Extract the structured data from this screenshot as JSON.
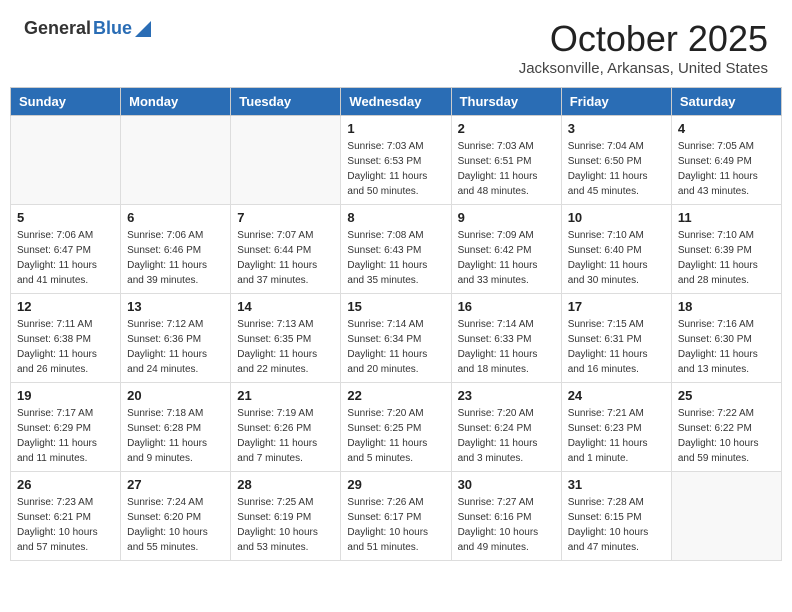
{
  "header": {
    "logo_general": "General",
    "logo_blue": "Blue",
    "month_title": "October 2025",
    "location": "Jacksonville, Arkansas, United States"
  },
  "calendar": {
    "days_of_week": [
      "Sunday",
      "Monday",
      "Tuesday",
      "Wednesday",
      "Thursday",
      "Friday",
      "Saturday"
    ],
    "weeks": [
      [
        {
          "day": "",
          "info": ""
        },
        {
          "day": "",
          "info": ""
        },
        {
          "day": "",
          "info": ""
        },
        {
          "day": "1",
          "info": "Sunrise: 7:03 AM\nSunset: 6:53 PM\nDaylight: 11 hours\nand 50 minutes."
        },
        {
          "day": "2",
          "info": "Sunrise: 7:03 AM\nSunset: 6:51 PM\nDaylight: 11 hours\nand 48 minutes."
        },
        {
          "day": "3",
          "info": "Sunrise: 7:04 AM\nSunset: 6:50 PM\nDaylight: 11 hours\nand 45 minutes."
        },
        {
          "day": "4",
          "info": "Sunrise: 7:05 AM\nSunset: 6:49 PM\nDaylight: 11 hours\nand 43 minutes."
        }
      ],
      [
        {
          "day": "5",
          "info": "Sunrise: 7:06 AM\nSunset: 6:47 PM\nDaylight: 11 hours\nand 41 minutes."
        },
        {
          "day": "6",
          "info": "Sunrise: 7:06 AM\nSunset: 6:46 PM\nDaylight: 11 hours\nand 39 minutes."
        },
        {
          "day": "7",
          "info": "Sunrise: 7:07 AM\nSunset: 6:44 PM\nDaylight: 11 hours\nand 37 minutes."
        },
        {
          "day": "8",
          "info": "Sunrise: 7:08 AM\nSunset: 6:43 PM\nDaylight: 11 hours\nand 35 minutes."
        },
        {
          "day": "9",
          "info": "Sunrise: 7:09 AM\nSunset: 6:42 PM\nDaylight: 11 hours\nand 33 minutes."
        },
        {
          "day": "10",
          "info": "Sunrise: 7:10 AM\nSunset: 6:40 PM\nDaylight: 11 hours\nand 30 minutes."
        },
        {
          "day": "11",
          "info": "Sunrise: 7:10 AM\nSunset: 6:39 PM\nDaylight: 11 hours\nand 28 minutes."
        }
      ],
      [
        {
          "day": "12",
          "info": "Sunrise: 7:11 AM\nSunset: 6:38 PM\nDaylight: 11 hours\nand 26 minutes."
        },
        {
          "day": "13",
          "info": "Sunrise: 7:12 AM\nSunset: 6:36 PM\nDaylight: 11 hours\nand 24 minutes."
        },
        {
          "day": "14",
          "info": "Sunrise: 7:13 AM\nSunset: 6:35 PM\nDaylight: 11 hours\nand 22 minutes."
        },
        {
          "day": "15",
          "info": "Sunrise: 7:14 AM\nSunset: 6:34 PM\nDaylight: 11 hours\nand 20 minutes."
        },
        {
          "day": "16",
          "info": "Sunrise: 7:14 AM\nSunset: 6:33 PM\nDaylight: 11 hours\nand 18 minutes."
        },
        {
          "day": "17",
          "info": "Sunrise: 7:15 AM\nSunset: 6:31 PM\nDaylight: 11 hours\nand 16 minutes."
        },
        {
          "day": "18",
          "info": "Sunrise: 7:16 AM\nSunset: 6:30 PM\nDaylight: 11 hours\nand 13 minutes."
        }
      ],
      [
        {
          "day": "19",
          "info": "Sunrise: 7:17 AM\nSunset: 6:29 PM\nDaylight: 11 hours\nand 11 minutes."
        },
        {
          "day": "20",
          "info": "Sunrise: 7:18 AM\nSunset: 6:28 PM\nDaylight: 11 hours\nand 9 minutes."
        },
        {
          "day": "21",
          "info": "Sunrise: 7:19 AM\nSunset: 6:26 PM\nDaylight: 11 hours\nand 7 minutes."
        },
        {
          "day": "22",
          "info": "Sunrise: 7:20 AM\nSunset: 6:25 PM\nDaylight: 11 hours\nand 5 minutes."
        },
        {
          "day": "23",
          "info": "Sunrise: 7:20 AM\nSunset: 6:24 PM\nDaylight: 11 hours\nand 3 minutes."
        },
        {
          "day": "24",
          "info": "Sunrise: 7:21 AM\nSunset: 6:23 PM\nDaylight: 11 hours\nand 1 minute."
        },
        {
          "day": "25",
          "info": "Sunrise: 7:22 AM\nSunset: 6:22 PM\nDaylight: 10 hours\nand 59 minutes."
        }
      ],
      [
        {
          "day": "26",
          "info": "Sunrise: 7:23 AM\nSunset: 6:21 PM\nDaylight: 10 hours\nand 57 minutes."
        },
        {
          "day": "27",
          "info": "Sunrise: 7:24 AM\nSunset: 6:20 PM\nDaylight: 10 hours\nand 55 minutes."
        },
        {
          "day": "28",
          "info": "Sunrise: 7:25 AM\nSunset: 6:19 PM\nDaylight: 10 hours\nand 53 minutes."
        },
        {
          "day": "29",
          "info": "Sunrise: 7:26 AM\nSunset: 6:17 PM\nDaylight: 10 hours\nand 51 minutes."
        },
        {
          "day": "30",
          "info": "Sunrise: 7:27 AM\nSunset: 6:16 PM\nDaylight: 10 hours\nand 49 minutes."
        },
        {
          "day": "31",
          "info": "Sunrise: 7:28 AM\nSunset: 6:15 PM\nDaylight: 10 hours\nand 47 minutes."
        },
        {
          "day": "",
          "info": ""
        }
      ]
    ]
  }
}
